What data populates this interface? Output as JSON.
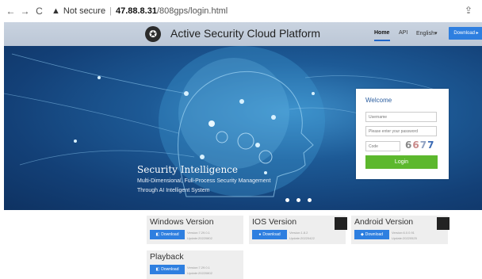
{
  "browser": {
    "warning": "Not secure",
    "host": "47.88.8.31",
    "path": "/808gps/login.html"
  },
  "header": {
    "title": "Active Security Cloud Platform",
    "menu": {
      "home": "Home",
      "api": "API",
      "lang": "English▾"
    },
    "download": "Download ▸"
  },
  "hero": {
    "title": "Security Intelligence",
    "subtitle1": "Multi-Dimensional, Full-Process Security Management",
    "subtitle2": "Through AI Intelligent System",
    "dots_count": 3
  },
  "login": {
    "title": "Welcome",
    "username_placeholder": "Username",
    "password_placeholder": "Please enter your password",
    "code_placeholder": "Code",
    "captcha": [
      "6",
      "6",
      "7",
      "7"
    ],
    "button": "Login"
  },
  "downloads": [
    {
      "title": "Windows Version",
      "button": "Download",
      "version": "Version:7.29.0.1",
      "update": "Update:20220802"
    },
    {
      "title": "IOS Version",
      "button": "Download",
      "version": "Version:1.8.2",
      "update": "Update:20220422"
    },
    {
      "title": "Android Version",
      "button": "Download",
      "version": "Version:6.0.0.91",
      "update": "Update:20220525"
    },
    {
      "title": "Playback",
      "button": "Download",
      "version": "Version:7.29.0.1",
      "update": "Update:20220802"
    }
  ],
  "colors": {
    "accent": "#2e7fe0",
    "login_green": "#5cb82d",
    "hero_dark": "#134077"
  }
}
